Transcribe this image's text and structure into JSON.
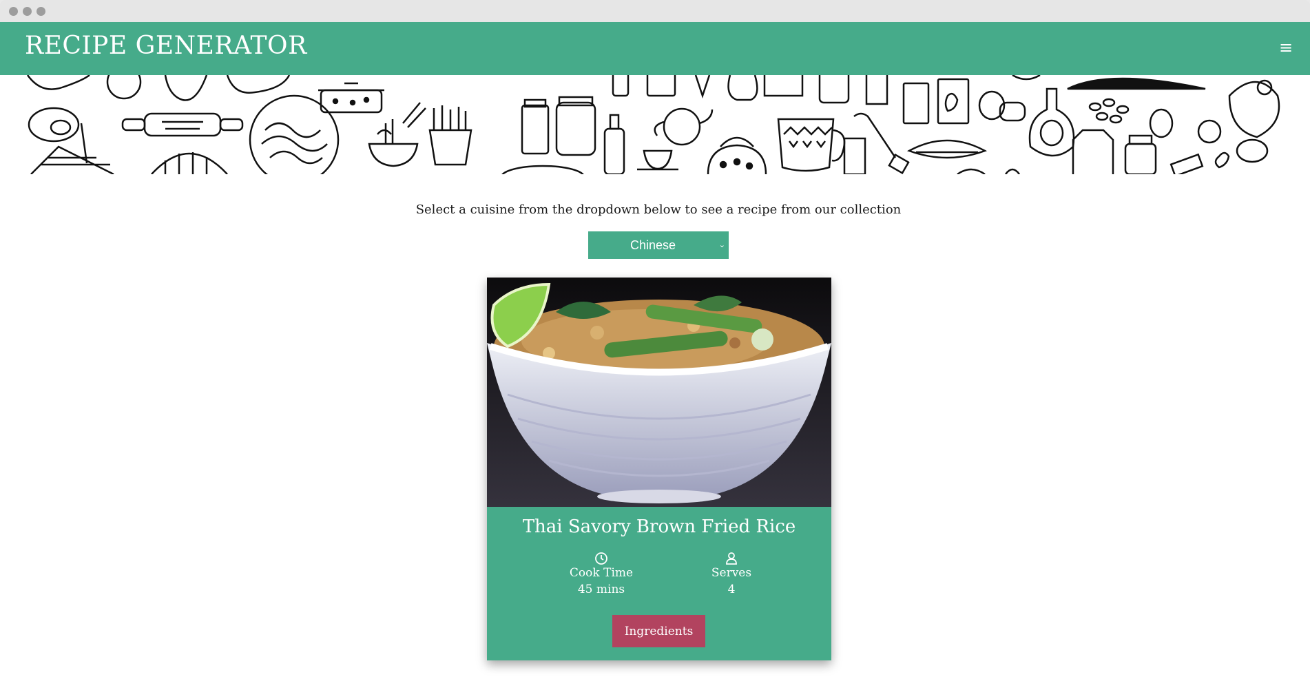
{
  "app": {
    "title": "RECIPE GENERATOR",
    "menu_icon": "hamburger-icon"
  },
  "intro": {
    "text": "Select a cuisine from the dropdown below to see a recipe from our collection"
  },
  "cuisine_select": {
    "selected": "Chinese",
    "caret": "⌄"
  },
  "recipe": {
    "title": "Thai Savory Brown Fried Rice",
    "cook_time_label": "Cook Time",
    "cook_time_value": "45 mins",
    "serves_label": "Serves",
    "serves_value": "4",
    "ingredients_button": "Ingredients"
  },
  "colors": {
    "brand_green": "#46ab8a",
    "button_red": "#b2435f"
  }
}
